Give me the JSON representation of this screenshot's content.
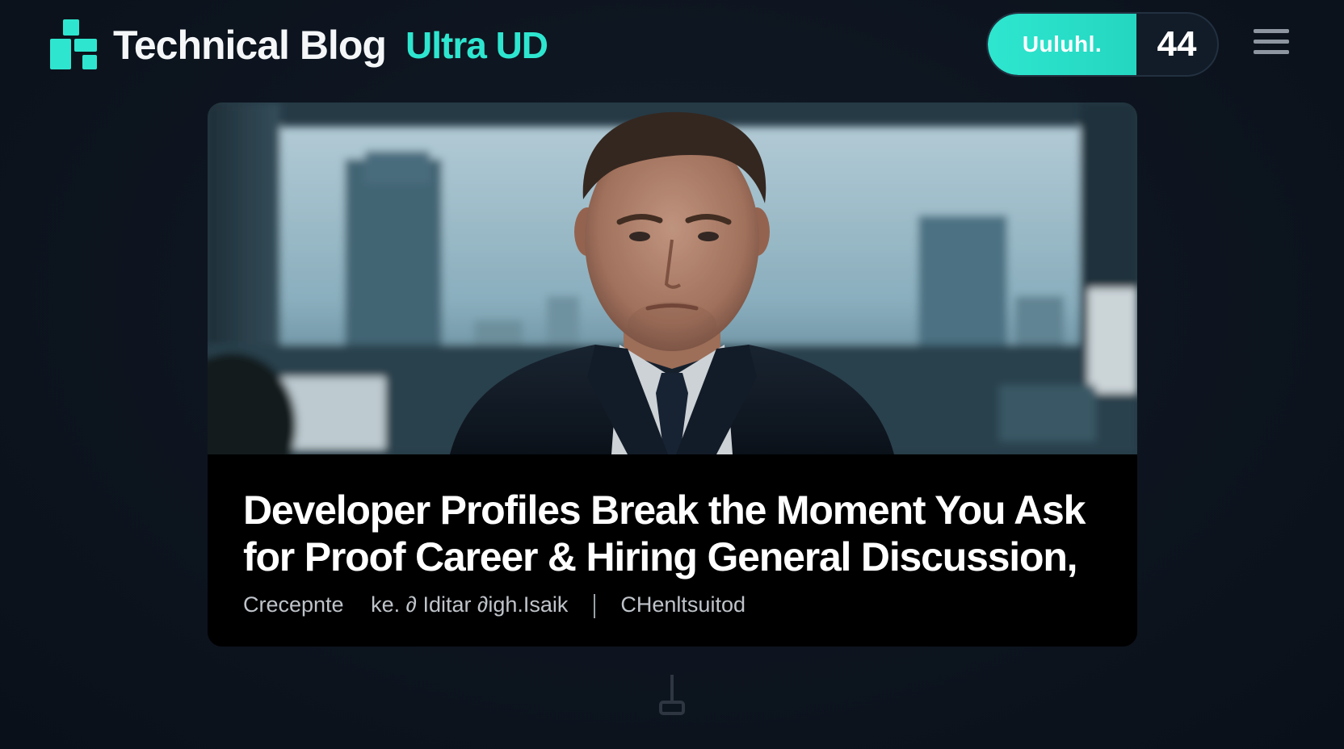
{
  "header": {
    "brand_title": "Technical Blog",
    "brand_subtitle": "Ultra UD",
    "logo_icon": "blocks-logo-icon",
    "pill_label": "Uuluhl.",
    "pill_count": "44",
    "menu_icon": "hamburger-menu-icon"
  },
  "card": {
    "image_alt": "Man in dark suit and tie in front of blurred office window",
    "title": "Developer Profiles Break the Moment You Ask for Proof Career & Hiring General Discussion,",
    "meta_author": "Crecepnte",
    "meta_tags": "ke. ∂ Iditar ∂igh.Isaik",
    "meta_category": "CHenltsuitod"
  },
  "colors": {
    "background": "#0d141f",
    "accent": "#2ee6cf",
    "card_background": "#000000"
  }
}
